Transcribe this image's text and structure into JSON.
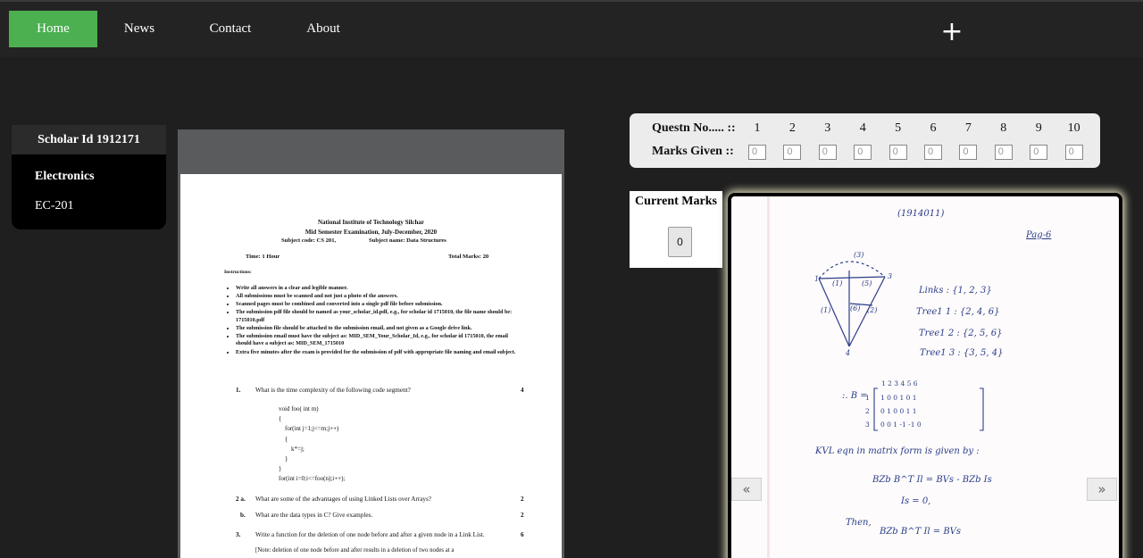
{
  "nav": {
    "items": [
      {
        "label": "Home",
        "active": true
      },
      {
        "label": "News",
        "active": false
      },
      {
        "label": "Contact",
        "active": false
      },
      {
        "label": "About",
        "active": false
      }
    ],
    "add_icon": "plus-icon"
  },
  "scholar": {
    "title": "Scholar Id 1912171",
    "department": "Electronics",
    "course": "EC-201"
  },
  "question_paper": {
    "institute": "National Institute of Technology Silchar",
    "exam": "Mid Semester Examination, July-December, 2020",
    "subject_code": "Subject code: CS 201,",
    "subject_name": "Subject name: Data Structures",
    "time": "Time: 1 Hour",
    "total_marks": "Total Marks: 20",
    "instructions_label": "Instructions:",
    "instructions": [
      "Write all answers in a clear and legible manner.",
      "All submissions must be scanned and not just a photo of the answers.",
      "Scanned pages must be combined and converted into a single pdf file before submission.",
      "The submission pdf file should be named as your_scholar_id.pdf, e.g., for scholar id 1715010, the file name should be: 1715010.pdf",
      "The submission file should be attached to the submission email, and not given as a Google drive link.",
      "The submission email must have the subject as: MID_SEM_Your_Scholar_Id, e.g., for scholar id 1715010, the email should have a subject as: MID_SEM_1715010",
      "Extra five minutes after the exam is provided for the submission of pdf with appropriate file naming and email subject."
    ],
    "q1": {
      "num": "1.",
      "text": "What is the time complexity of the following code segment?",
      "marks": "4"
    },
    "code": "void foo( int m)\n{\n    for(int j=1;j<=m;j++)\n    {\n        k*=j;\n    }\n}\nfor(int i=0;i<=foo(n);i++);",
    "q2a": {
      "num": "2 a.",
      "text": "What are some of the advantages of using Linked Lists over Arrays?",
      "marks": "2"
    },
    "q2b": {
      "num": "b.",
      "text": "What are the data types in C? Give examples.",
      "marks": "2"
    },
    "q3": {
      "num": "3.",
      "text": "Write a function for the deletion of one node before and after a given node in a Link List.",
      "marks": "6"
    },
    "q3_note": "[Note: deletion of one node before and after results in a deletion of two nodes at a"
  },
  "marks_panel": {
    "question_label": "Questn No..... ::",
    "marks_label": "Marks Given ::",
    "questions": [
      "1",
      "2",
      "3",
      "4",
      "5",
      "6",
      "7",
      "8",
      "9",
      "10"
    ],
    "placeholder": "0"
  },
  "current_marks": {
    "title": "Current Marks",
    "value": "0"
  },
  "answer_sheet": {
    "scholar_tag": "(1914011)",
    "page_tag": "Pag-6",
    "links": "Links : {1, 2, 3}",
    "tree1": "Tree1 1 : {2, 4, 6}",
    "tree2": "Tree1 2 : {2, 5, 6}",
    "tree3": "Tree1 3 : {3, 5, 4}",
    "b_matrix_label": ":. B =",
    "kvl_text": "KVL eqn in matrix form is given by :",
    "eq1": "BZb B^T Il = BVs - BZb Is",
    "eq2": "Is = 0,",
    "eq3_prefix": "Then,",
    "eq3": "BZb B^T Il = BVs",
    "prev_icon": "double-chevron-left-icon",
    "next_icon": "double-chevron-right-icon",
    "prev_label": "«",
    "next_label": "»"
  },
  "colors": {
    "page_bg": "#1f1f1f",
    "nav_bg": "#232323",
    "nav_active": "#4caf50",
    "panel_bg": "#ececec",
    "ink": "#2a3c8a"
  }
}
